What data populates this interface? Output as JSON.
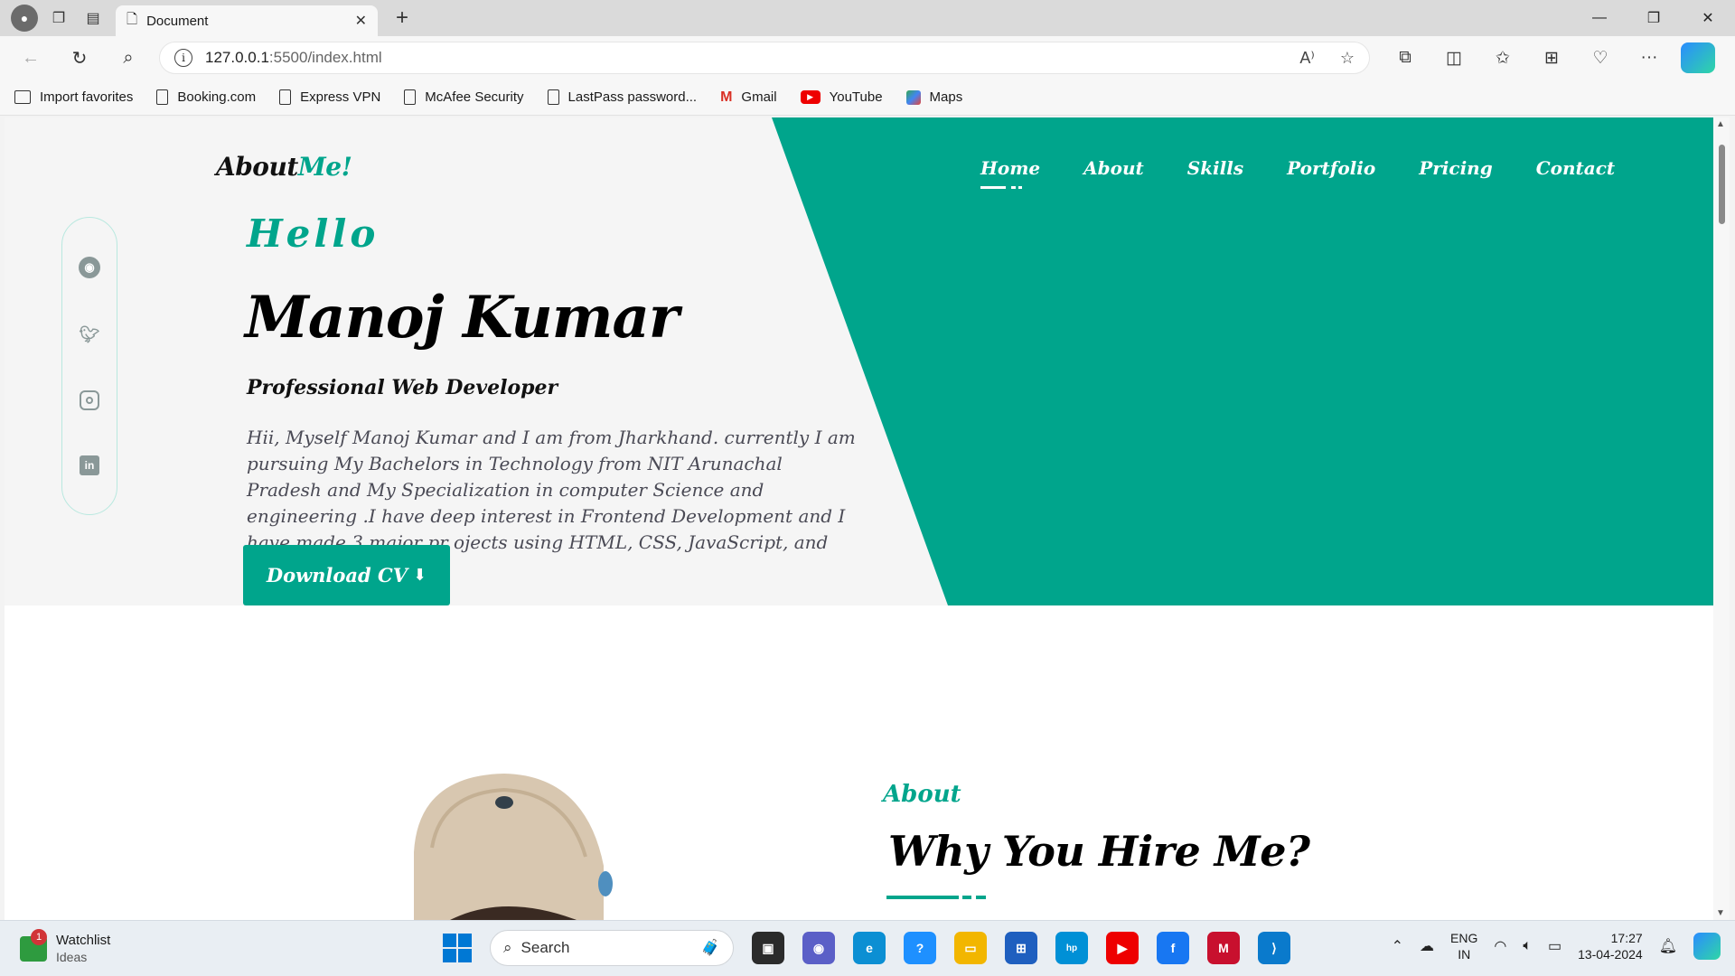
{
  "browser": {
    "tab_title": "Document",
    "url_host": "127.0.0.1",
    "url_rest": ":5500/index.html",
    "favorites": [
      {
        "label": "Import favorites",
        "icon": "import-icon"
      },
      {
        "label": "Booking.com",
        "icon": "page-icon"
      },
      {
        "label": "Express VPN",
        "icon": "page-icon"
      },
      {
        "label": "McAfee Security",
        "icon": "page-icon"
      },
      {
        "label": "LastPass password...",
        "icon": "page-icon"
      },
      {
        "label": "Gmail",
        "icon": "gmail-icon"
      },
      {
        "label": "YouTube",
        "icon": "youtube-icon"
      },
      {
        "label": "Maps",
        "icon": "maps-icon"
      }
    ]
  },
  "site": {
    "logo_main": "About",
    "logo_accent": "Me!",
    "nav": [
      "Home",
      "About",
      "Skills",
      "Portfolio",
      "Pricing",
      "Contact"
    ],
    "active_nav": "Home",
    "hero": {
      "greeting": "Hello",
      "name": "Manoj Kumar",
      "role": "Professional Web Developer",
      "bio": "Hii, Myself Manoj Kumar and I am from Jharkhand. currently I am pursuing My Bachelors in Technology from NIT Arunachal Pradesh and My Specialization in computer Science and engineering .I have deep interest in Frontend Development and I have made 3 major pr ojects using HTML, CSS, JavaScript, and React.js.",
      "cv_button": "Download CV"
    },
    "about": {
      "label": "About",
      "title": "Why You Hire Me?"
    },
    "colors": {
      "accent": "#00a58c"
    }
  },
  "taskbar": {
    "widget_title": "Watchlist",
    "widget_sub": "Ideas",
    "widget_badge": "1",
    "search_placeholder": "Search",
    "lang_top": "ENG",
    "lang_bottom": "IN",
    "time": "17:27",
    "date": "13-04-2024"
  }
}
